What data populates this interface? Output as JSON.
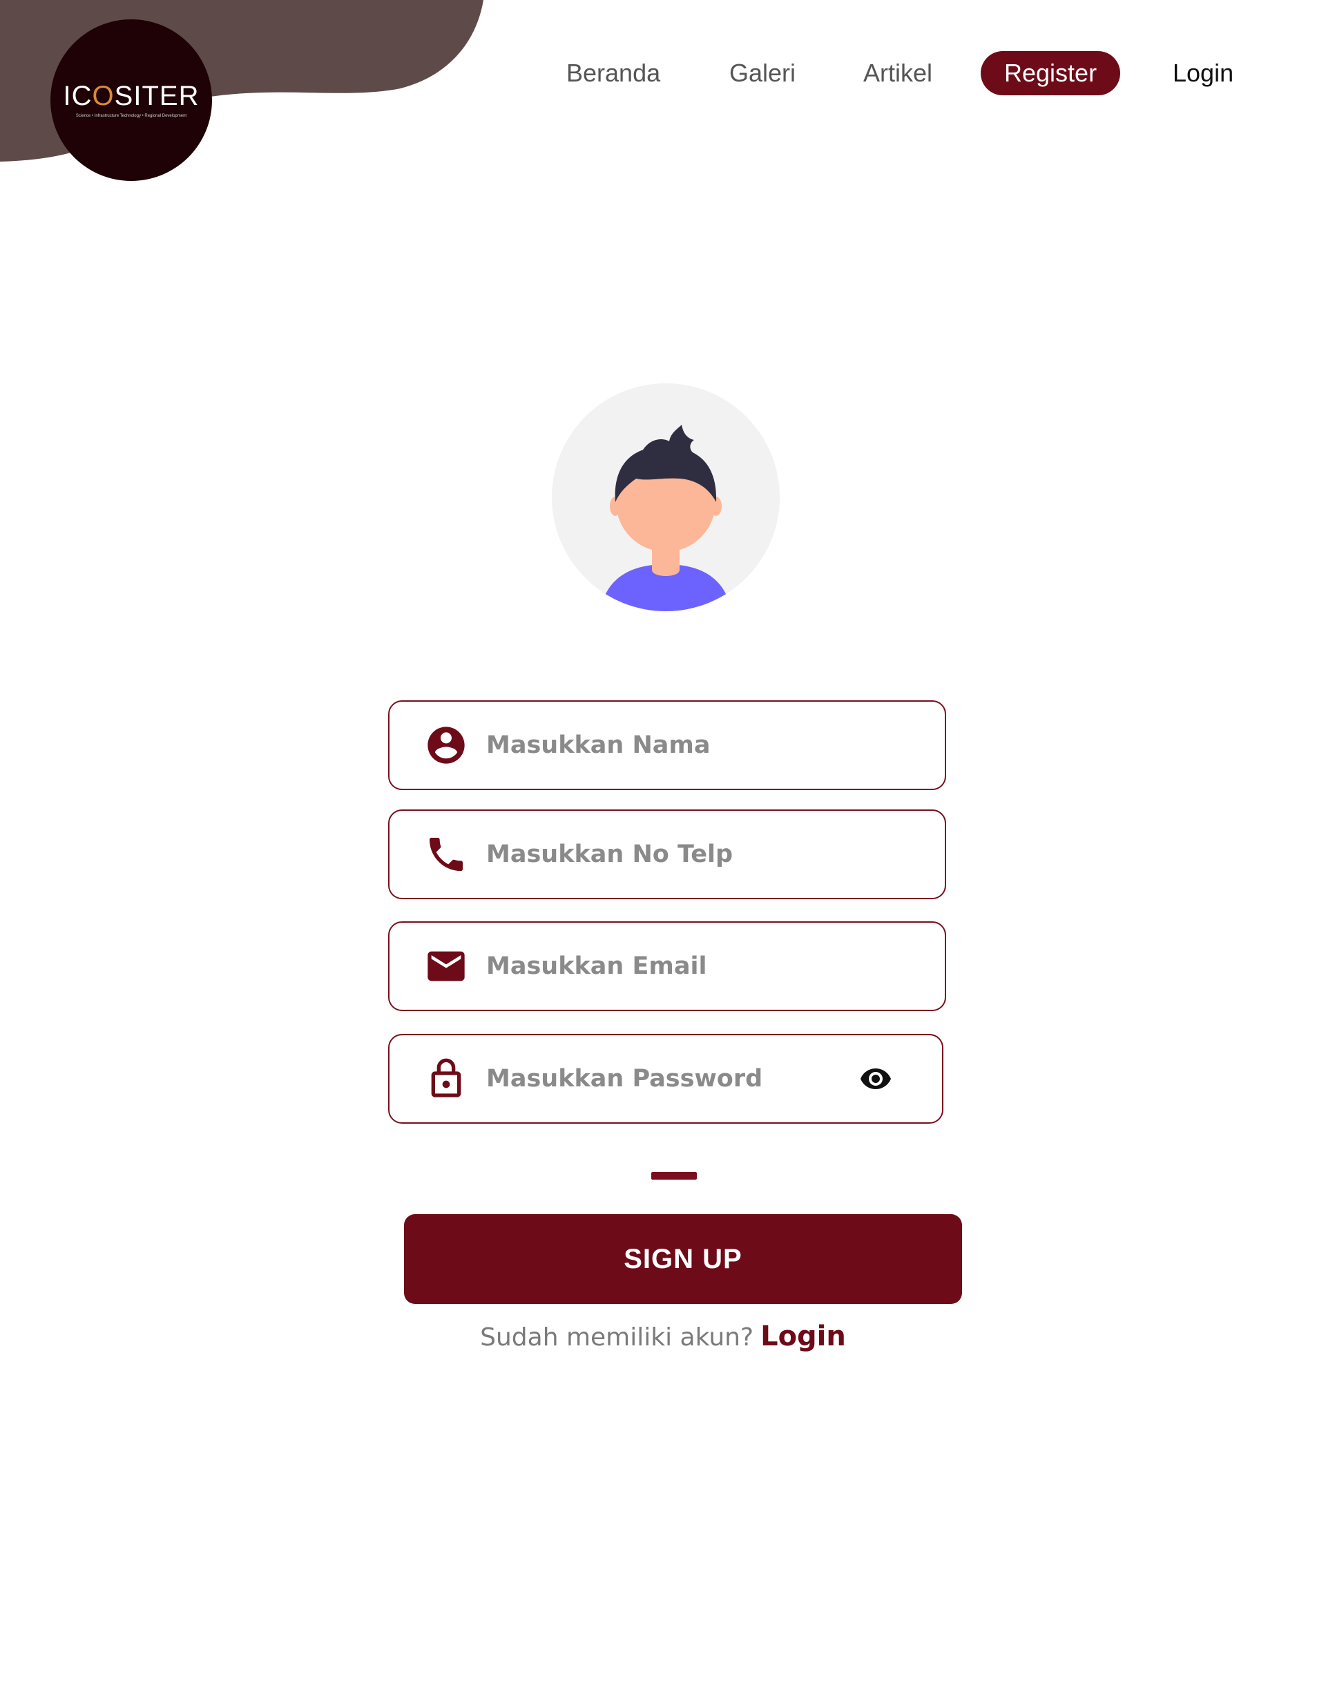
{
  "brand": {
    "logo_text_prefix": "IC",
    "logo_text_o": "O",
    "logo_text_suffix": "SITER",
    "logo_tagline": "Science • Infrastructure Technology • Regional Development",
    "colors": {
      "primary": "#6e0b18",
      "blob": "#5e4b49",
      "logo_bg": "#1e0205"
    }
  },
  "nav": {
    "items": [
      {
        "label": "Beranda"
      },
      {
        "label": "Galeri"
      },
      {
        "label": "Artikel"
      },
      {
        "label": "Register"
      },
      {
        "label": "Login"
      }
    ]
  },
  "form": {
    "name": {
      "placeholder": "Masukkan Nama",
      "value": "",
      "icon": "account-circle-icon"
    },
    "phone": {
      "placeholder": "Masukkan No Telp",
      "value": "",
      "icon": "phone-icon"
    },
    "email": {
      "placeholder": "Masukkan Email",
      "value": "",
      "icon": "mail-icon"
    },
    "password": {
      "placeholder": "Masukkan Password",
      "value": "",
      "icon": "lock-icon",
      "toggle_icon": "eye-icon"
    },
    "submit_label": "SIGN UP"
  },
  "footer": {
    "question": "Sudah memiliki akun?",
    "login_label": "Login"
  }
}
